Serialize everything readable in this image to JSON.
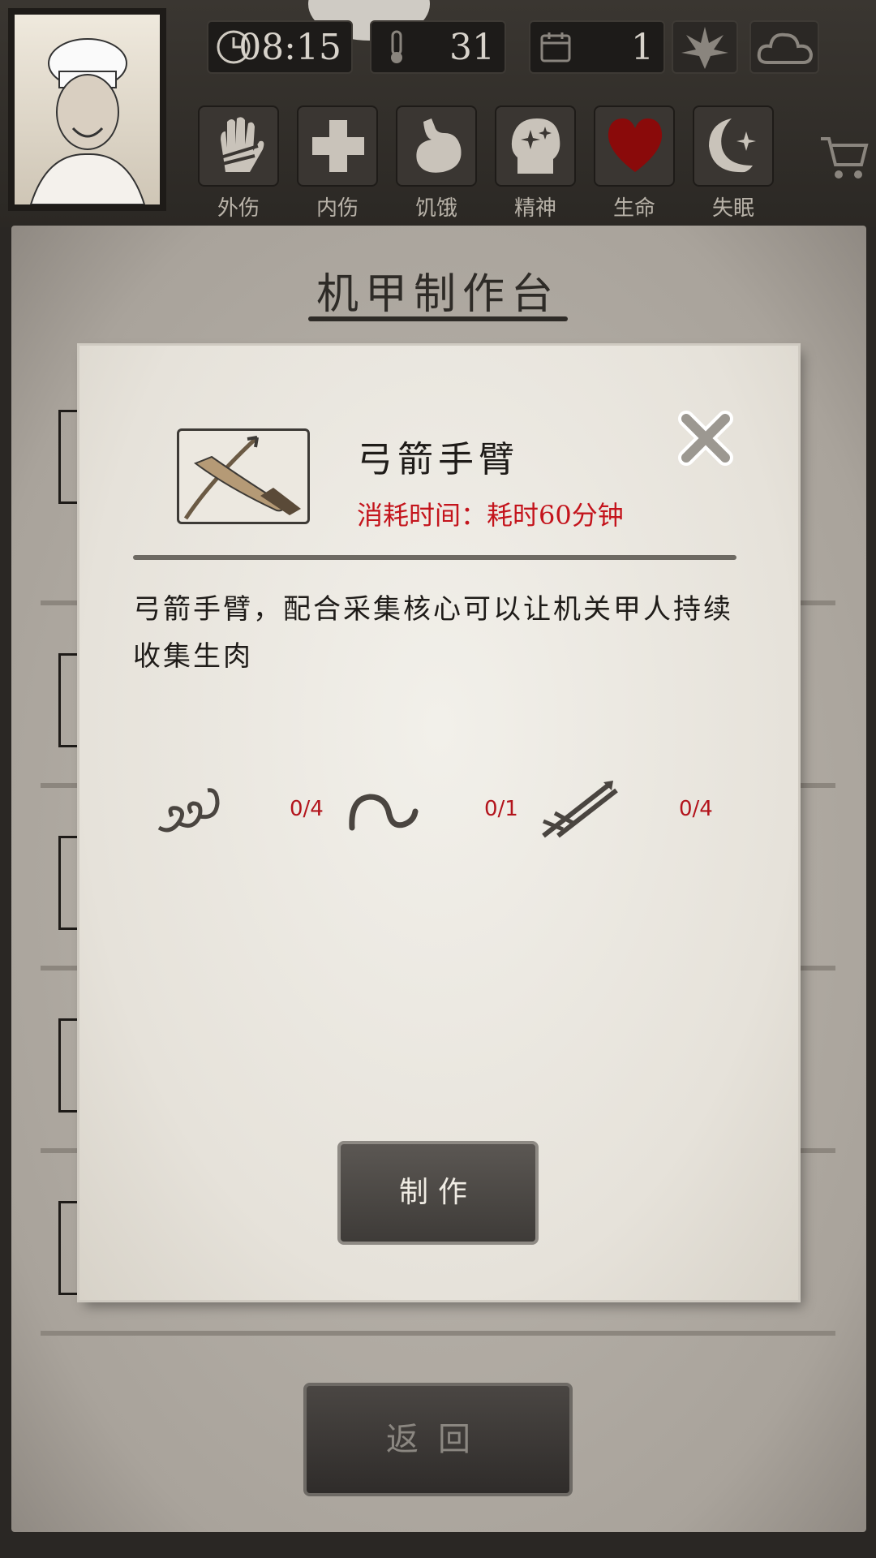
{
  "hud": {
    "time": "08:15",
    "temperature": "31",
    "day": "1",
    "time_icon": "clock-icon",
    "temp_icon": "thermometer-icon",
    "day_icon": "calendar-icon",
    "season_icon": "leaf-icon",
    "weather_icon": "cloud-icon",
    "status": [
      {
        "label": "外伤",
        "icon": "hand-bandage-icon"
      },
      {
        "label": "内伤",
        "icon": "cross-icon"
      },
      {
        "label": "饥饿",
        "icon": "stomach-icon"
      },
      {
        "label": "精神",
        "icon": "head-sparkle-icon"
      },
      {
        "label": "生命",
        "icon": "heart-icon"
      },
      {
        "label": "失眠",
        "icon": "moon-star-icon"
      }
    ],
    "shop_icon": "cart-icon"
  },
  "page": {
    "title": "机甲制作台"
  },
  "modal": {
    "item_name": "弓箭手臂",
    "time_cost": "消耗时间：耗时60分钟",
    "description": "弓箭手臂，配合采集核心可以让机关甲人持续收集生肉",
    "materials": [
      {
        "icon": "spring-icon",
        "count": "0/4"
      },
      {
        "icon": "rope-icon",
        "count": "0/1"
      },
      {
        "icon": "arrows-icon",
        "count": "0/4"
      }
    ],
    "craft_label": "制作"
  },
  "back_label": "返回",
  "colors": {
    "accent_red": "#c4141c",
    "paper": "#e6e2da",
    "heart": "#8a0a0a"
  }
}
